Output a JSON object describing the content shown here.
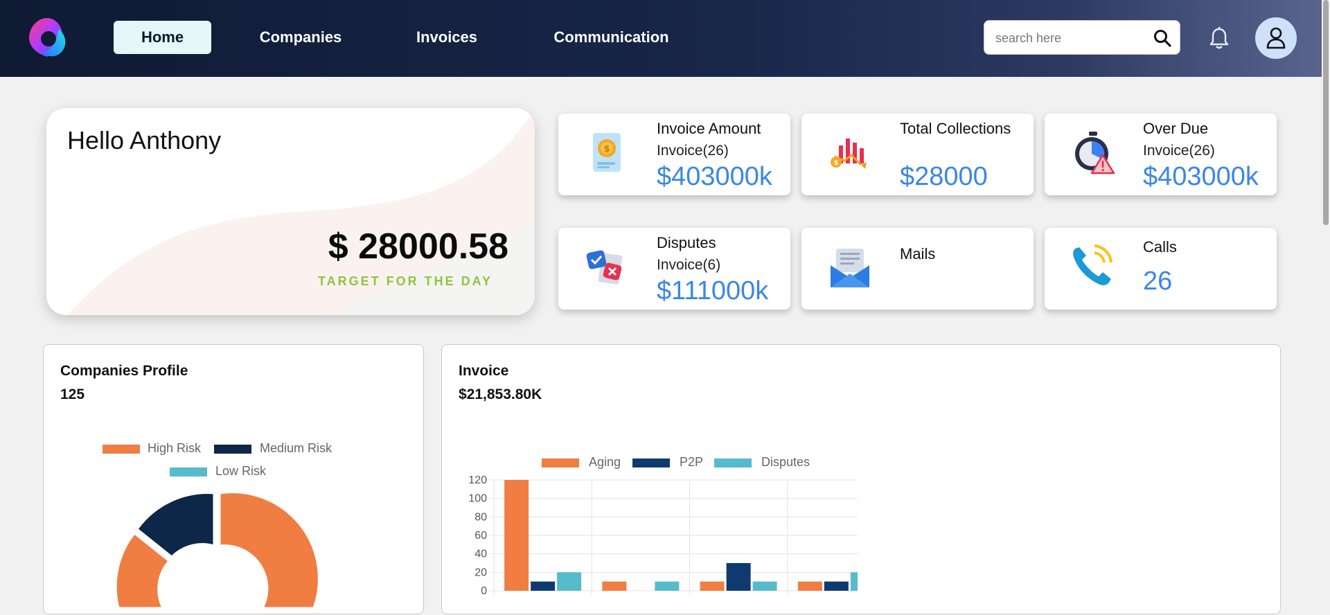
{
  "nav": {
    "tabs": [
      {
        "label": "Home",
        "active": true
      },
      {
        "label": "Companies",
        "active": false
      },
      {
        "label": "Invoices",
        "active": false
      },
      {
        "label": "Communication",
        "active": false
      }
    ],
    "search_placeholder": "search here",
    "icons": {
      "search": "search-icon",
      "notifications": "bell-icon",
      "profile": "user-icon"
    }
  },
  "hello": {
    "greeting": "Hello Anthony",
    "amount": "$ 28000.58",
    "target_label": "TARGET FOR THE DAY"
  },
  "stats": [
    {
      "title": "Invoice Amount",
      "sub": "Invoice(26)",
      "value": "$403000k",
      "icon": "invoice-coin-icon"
    },
    {
      "title": "Total Collections",
      "sub": "",
      "value": "$28000",
      "icon": "collections-chart-icon"
    },
    {
      "title": "Over Due",
      "sub": "Invoice(26)",
      "value": "$403000k",
      "icon": "overdue-stopwatch-icon"
    },
    {
      "title": "Disputes",
      "sub": "Invoice(6)",
      "value": "$111000k",
      "icon": "disputes-icon"
    },
    {
      "title": "Mails",
      "sub": "",
      "value": "",
      "icon": "mail-icon"
    },
    {
      "title": "Calls",
      "sub": "",
      "value": "26",
      "icon": "phone-call-icon"
    }
  ],
  "colors": {
    "accent_value": "#3a86e8",
    "target_green": "#8dc63f",
    "high_risk": "#f07d42",
    "medium_risk": "#0e2648",
    "low_risk": "#56bccb",
    "aging": "#f07d42",
    "p2p": "#0e3a70",
    "disputes": "#56bccb"
  },
  "companies_panel": {
    "title": "Companies Profile",
    "count": "125"
  },
  "invoice_panel": {
    "title": "Invoice",
    "total": "$21,853.80K"
  },
  "chart_data": [
    {
      "type": "pie",
      "variant": "doughnut",
      "legend": [
        "High Risk",
        "Medium Risk",
        "Low Risk"
      ],
      "legend_position": "top",
      "partial_view": true
    },
    {
      "type": "bar",
      "categories": [
        "",
        "",
        "",
        ""
      ],
      "series": [
        {
          "name": "Aging",
          "values": [
            120,
            10,
            10,
            10
          ]
        },
        {
          "name": "P2P",
          "values": [
            10,
            0,
            30,
            10
          ]
        },
        {
          "name": "Disputes",
          "values": [
            20,
            10,
            10,
            20
          ]
        }
      ],
      "ylim": [
        0,
        120
      ],
      "yticks": [
        "0",
        "20",
        "40",
        "60",
        "80",
        "100",
        "120"
      ],
      "legend_position": "top",
      "grid": true
    }
  ]
}
